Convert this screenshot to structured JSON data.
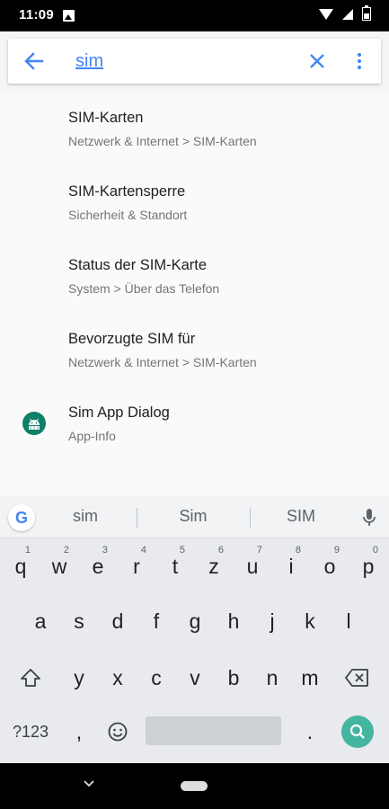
{
  "status": {
    "time": "11:09"
  },
  "search": {
    "query": "sim"
  },
  "results": [
    {
      "title": "SIM-Karten",
      "summary": "Netzwerk & Internet > SIM-Karten"
    },
    {
      "title": "SIM-Kartensperre",
      "summary": "Sicherheit & Standort"
    },
    {
      "title": "Status der SIM-Karte",
      "summary": "System > Über das Telefon"
    },
    {
      "title": "Bevorzugte SIM für",
      "summary": "Netzwerk & Internet > SIM-Karten"
    },
    {
      "title": "Sim App Dialog",
      "summary": "App-Info",
      "icon": "android-icon"
    }
  ],
  "keyboard": {
    "suggestions": [
      "sim",
      "Sim",
      "SIM"
    ],
    "row1": [
      "q",
      "w",
      "e",
      "r",
      "t",
      "z",
      "u",
      "i",
      "o",
      "p"
    ],
    "row1_hints": [
      "1",
      "2",
      "3",
      "4",
      "5",
      "6",
      "7",
      "8",
      "9",
      "0"
    ],
    "row2": [
      "a",
      "s",
      "d",
      "f",
      "g",
      "h",
      "j",
      "k",
      "l"
    ],
    "row3": [
      "y",
      "x",
      "c",
      "v",
      "b",
      "n",
      "m"
    ],
    "symbols_label": "?123",
    "comma": ",",
    "period": ".",
    "accent_color": "#43b5a1"
  },
  "colors": {
    "accent": "#4285f4",
    "app_icon": "#0e7f68"
  }
}
